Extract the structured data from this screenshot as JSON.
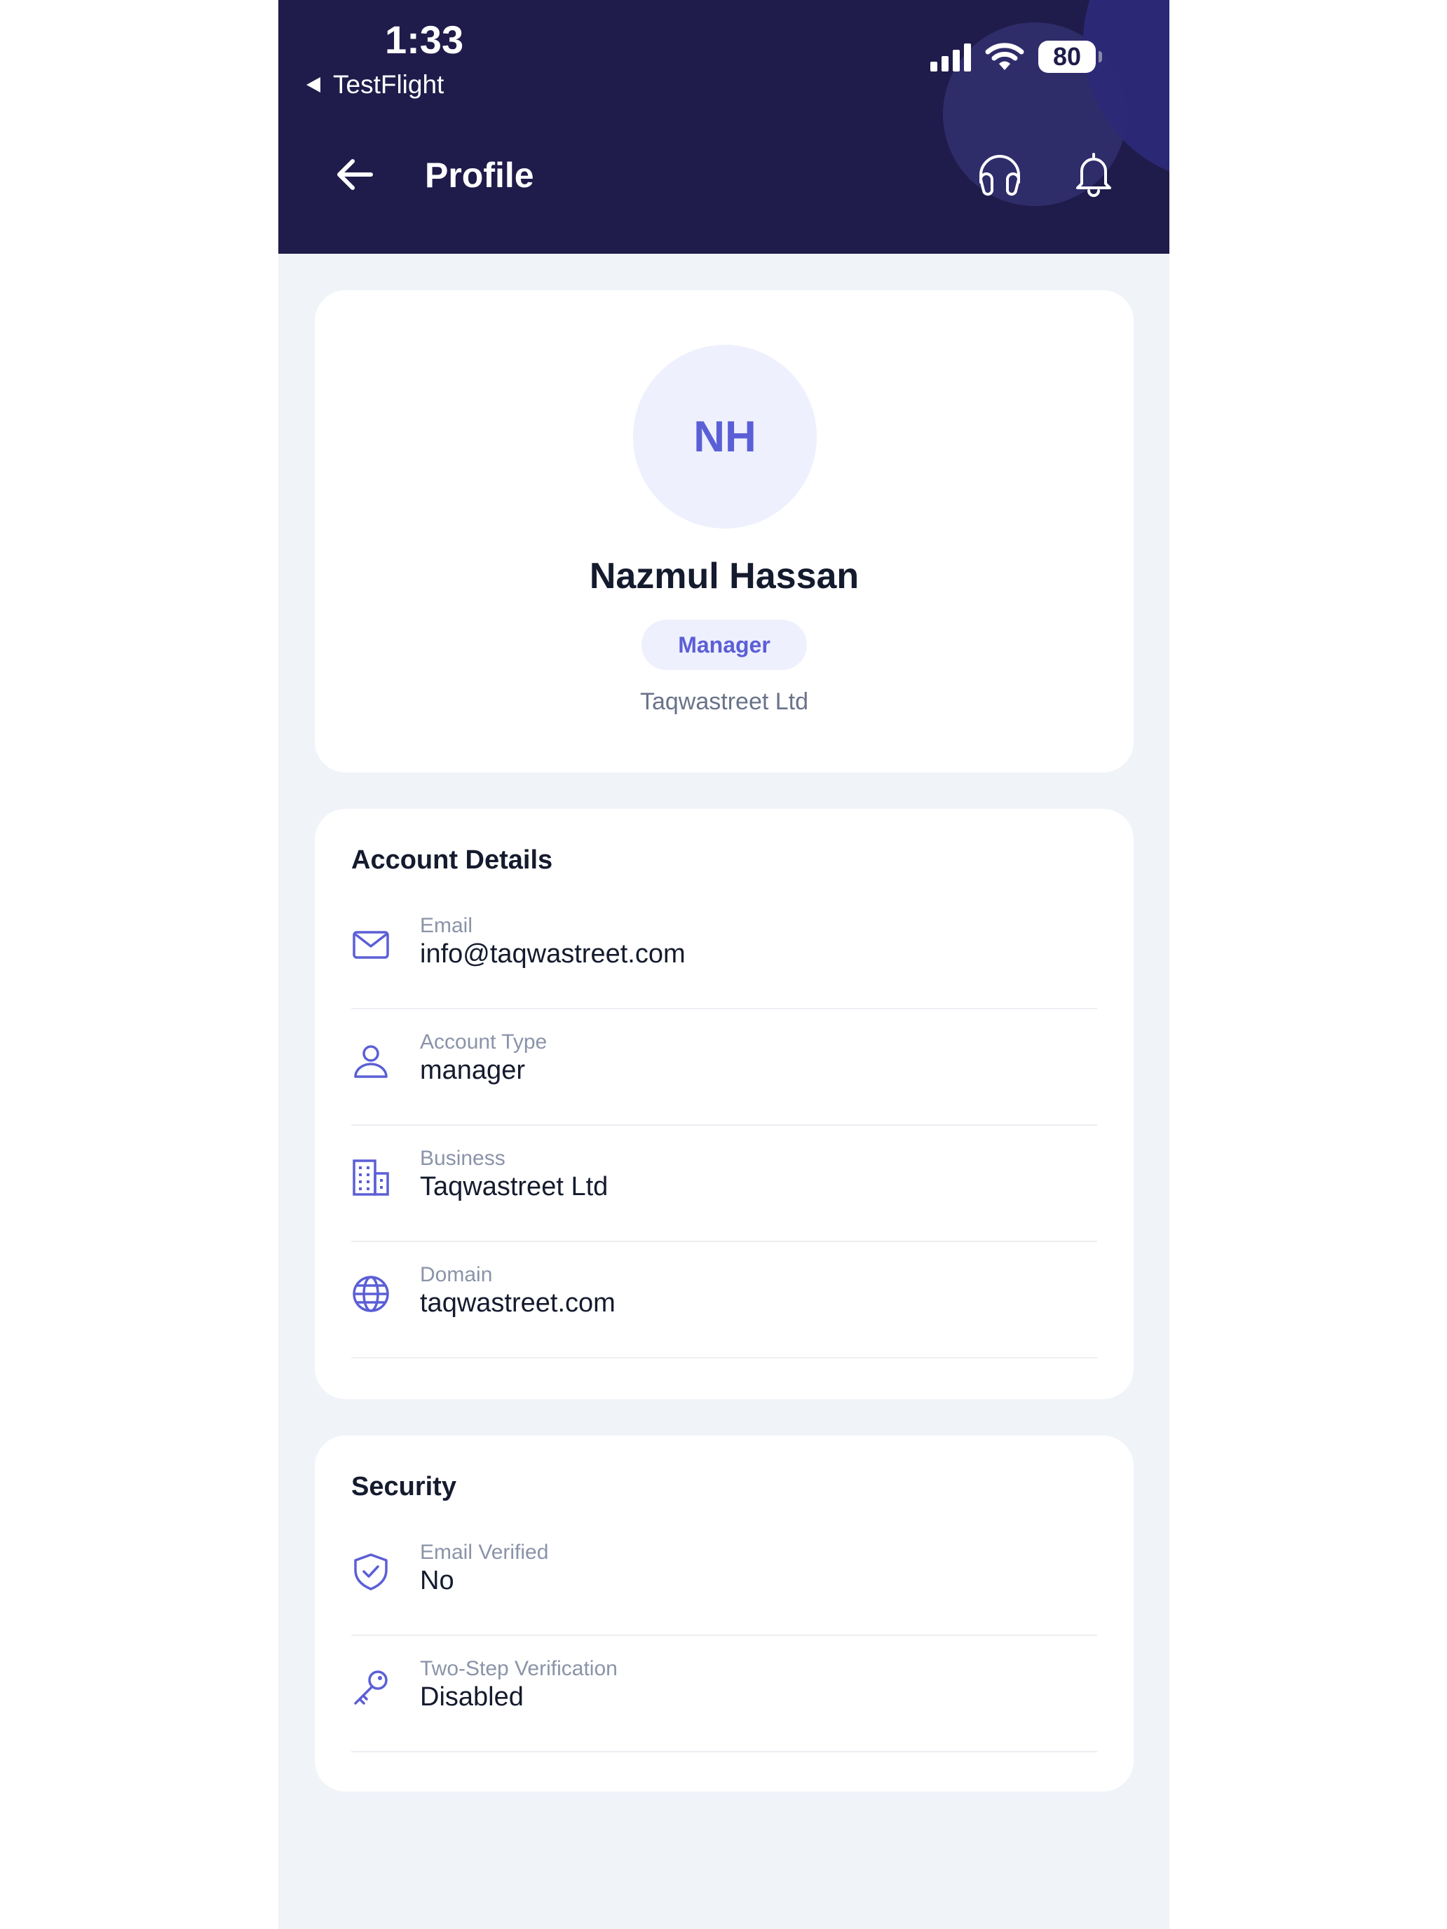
{
  "status_bar": {
    "time": "1:33",
    "back_app": "TestFlight",
    "battery": "80"
  },
  "nav": {
    "title": "Profile"
  },
  "profile": {
    "initials": "NH",
    "name": "Nazmul Hassan",
    "role": "Manager",
    "company": "Taqwastreet Ltd"
  },
  "account_details": {
    "title": "Account Details",
    "rows": [
      {
        "label": "Email",
        "value": "info@taqwastreet.com",
        "icon": "mail-icon"
      },
      {
        "label": "Account Type",
        "value": "manager",
        "icon": "user-icon"
      },
      {
        "label": "Business",
        "value": "Taqwastreet Ltd",
        "icon": "building-icon"
      },
      {
        "label": "Domain",
        "value": "taqwastreet.com",
        "icon": "globe-icon"
      }
    ]
  },
  "security": {
    "title": "Security",
    "rows": [
      {
        "label": "Email Verified",
        "value": "No",
        "icon": "shield-check-icon"
      },
      {
        "label": "Two-Step Verification",
        "value": "Disabled",
        "icon": "key-icon"
      }
    ]
  },
  "colors": {
    "header": "#1f1c4b",
    "accent": "#5b5fd6",
    "background": "#f0f3f8"
  }
}
